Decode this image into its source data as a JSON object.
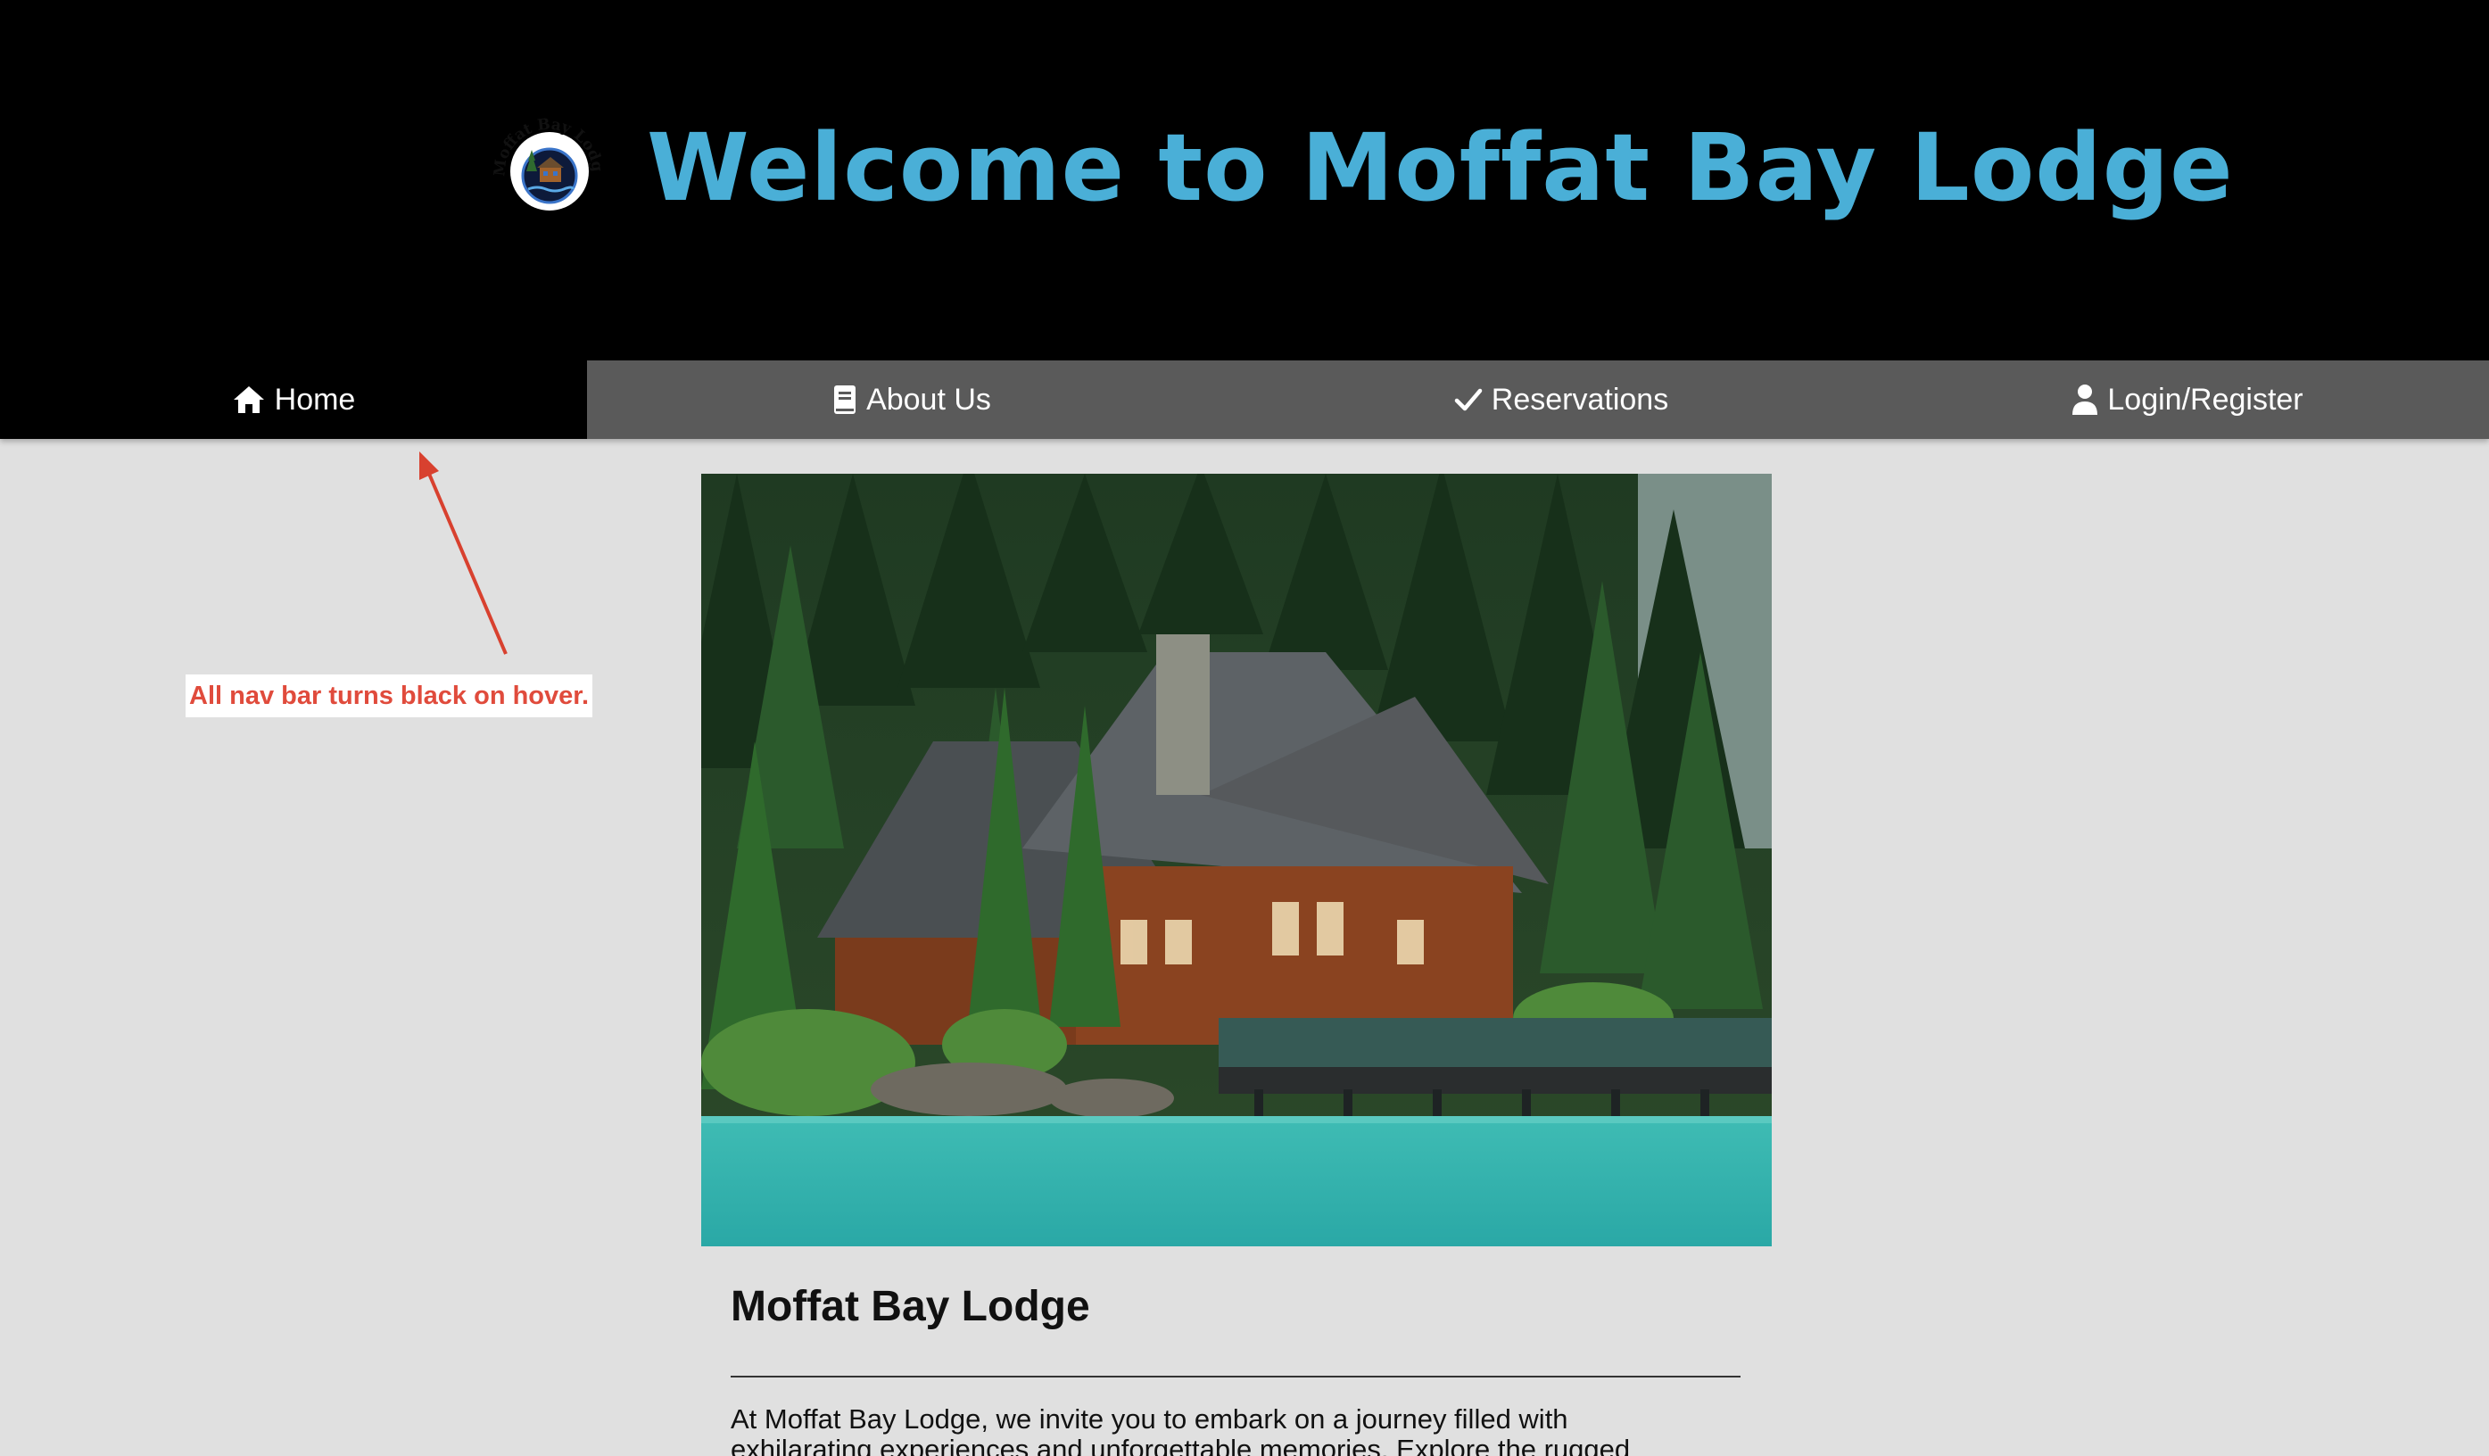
{
  "header": {
    "title": "Welcome to Moffat Bay Lodge",
    "logo_text": "Moffat Bay Lodge",
    "accent_color": "#4aafd7"
  },
  "nav": {
    "items": [
      {
        "label": "Home",
        "icon": "home-icon",
        "active": true
      },
      {
        "label": "About Us",
        "icon": "book-icon",
        "active": false
      },
      {
        "label": "Reservations",
        "icon": "checkmark-icon",
        "active": false
      },
      {
        "label": "Login/Register",
        "icon": "user-icon",
        "active": false
      }
    ],
    "bar_color": "#5a5a5a",
    "hover_color": "#000000"
  },
  "annotation": {
    "text": "All nav bar turns black on hover.",
    "color": "#e04b3c"
  },
  "main": {
    "hero_image": "lodge-on-lake-photo",
    "heading": "Moffat Bay Lodge",
    "intro_line1": "At Moffat Bay Lodge, we invite you to embark on a journey filled with",
    "intro_line2": "exhilarating experiences and unforgettable memories. Explore the rugged"
  }
}
